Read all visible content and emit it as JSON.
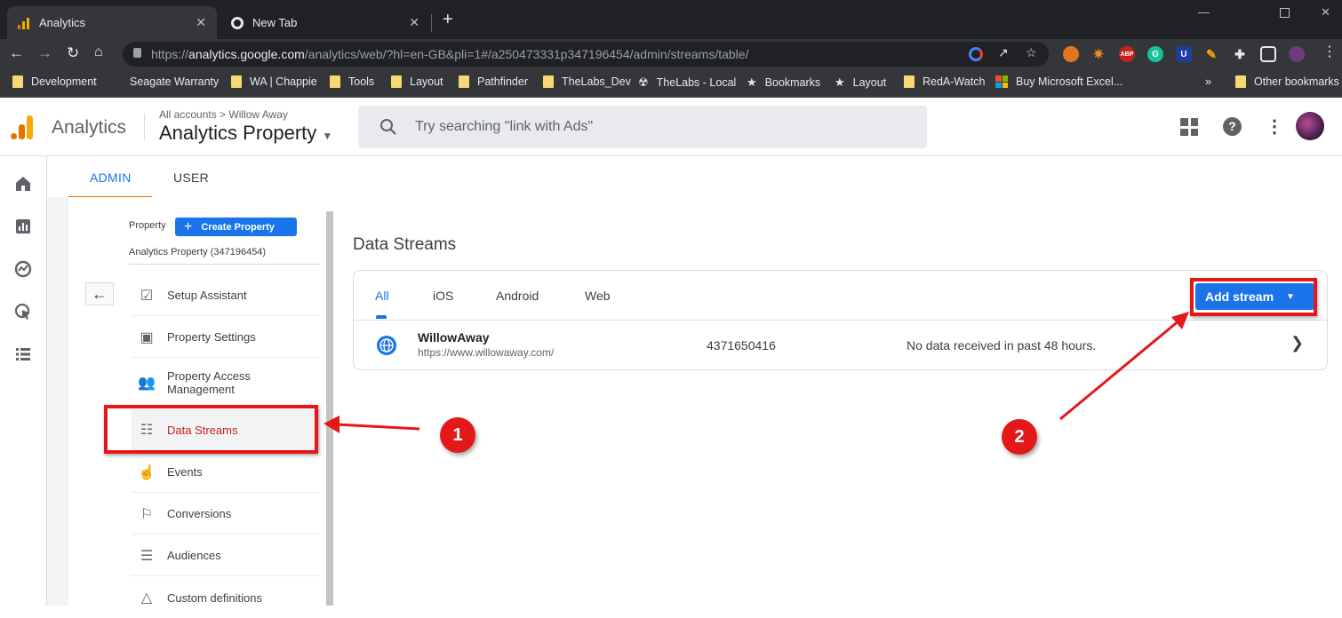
{
  "browser": {
    "tabs": [
      {
        "title": "Analytics"
      },
      {
        "title": "New Tab"
      }
    ],
    "url_prefix": "https://",
    "url_host": "analytics.google.com",
    "url_path": "/analytics/web/?hl=en-GB&pli=1#/a250473331p347196454/admin/streams/table/",
    "bookmarks": [
      "Development",
      "Seagate Warranty",
      "WA | Chappie",
      "Tools",
      "Layout",
      "Pathfinder",
      "TheLabs_Dev",
      "TheLabs - Local",
      "Bookmarks",
      "Layout",
      "RedA-Watch",
      "Buy Microsoft Excel..."
    ],
    "other_bookmarks": "Other bookmarks",
    "ext_badge": "ABP",
    "ext_count": "1"
  },
  "header": {
    "app_name": "Analytics",
    "breadcrumb_all": "All accounts",
    "breadcrumb_sep": ">",
    "breadcrumb_account": "Willow Away",
    "property_name": "Analytics Property",
    "search_placeholder": "Try searching \"link with Ads\""
  },
  "admin": {
    "tabs": [
      "ADMIN",
      "USER"
    ],
    "property_label": "Property",
    "create_property": "Create Property",
    "property_id_label": "Analytics Property (347196454)",
    "nav": [
      {
        "label": "Setup Assistant",
        "icon": "checkbox-icon"
      },
      {
        "label": "Property Settings",
        "icon": "layout-icon"
      },
      {
        "label": "Property Access Management",
        "icon": "people-icon"
      },
      {
        "label": "Data Streams",
        "icon": "streams-icon"
      },
      {
        "label": "Events",
        "icon": "touch-icon"
      },
      {
        "label": "Conversions",
        "icon": "flag-icon"
      },
      {
        "label": "Audiences",
        "icon": "audience-icon"
      },
      {
        "label": "Custom definitions",
        "icon": "shapes-icon"
      }
    ]
  },
  "streams": {
    "title": "Data Streams",
    "filters": [
      "All",
      "iOS",
      "Android",
      "Web"
    ],
    "add_stream": "Add stream",
    "rows": [
      {
        "name": "WillowAway",
        "url": "https://www.willowaway.com/",
        "id": "4371650416",
        "status": "No data received in past 48 hours."
      }
    ]
  },
  "annotations": {
    "step1": "1",
    "step2": "2"
  },
  "colors": {
    "accent_blue": "#1a73e8",
    "annotation_red": "#e31919",
    "active_nav_text": "#c5221f"
  }
}
